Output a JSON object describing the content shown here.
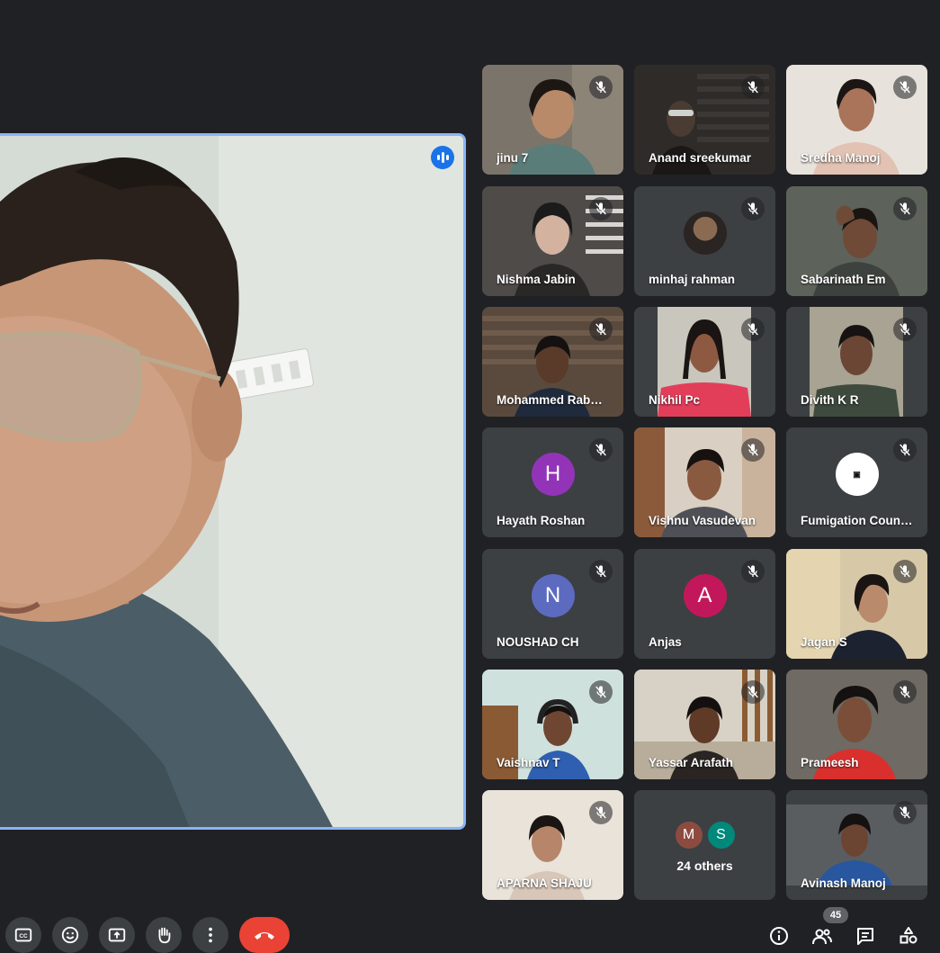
{
  "colors": {
    "background": "#202124",
    "tile": "#3c4043",
    "speaker_outline": "#8ab4f8",
    "speaking_indicator": "#1a73e8",
    "end_call": "#ea4335"
  },
  "main_speaker": {
    "speaking_icon": "audio-level-icon"
  },
  "participants": [
    {
      "name": "jinu 7",
      "muted": true
    },
    {
      "name": "Anand sreekumar",
      "muted": true
    },
    {
      "name": "Sredha Manoj",
      "muted": true
    },
    {
      "name": "Nishma Jabin",
      "muted": true
    },
    {
      "name": "minhaj rahman",
      "muted": true
    },
    {
      "name": "Sabarinath Em",
      "muted": true
    },
    {
      "name": "Mohammed Rab…",
      "muted": true
    },
    {
      "name": "Nikhil Pc",
      "muted": true
    },
    {
      "name": "Divith K R",
      "muted": true
    },
    {
      "name": "Hayath Roshan",
      "muted": true,
      "avatar_letter": "H",
      "avatar_color": "#9334b8"
    },
    {
      "name": "Vishnu Vasudevan",
      "muted": true
    },
    {
      "name": "Fumigation Coun…",
      "muted": true
    },
    {
      "name": "NOUSHAD CH",
      "muted": true,
      "avatar_letter": "N",
      "avatar_color": "#5c6bc0"
    },
    {
      "name": "Anjas",
      "muted": true,
      "avatar_letter": "A",
      "avatar_color": "#c2185b"
    },
    {
      "name": "Jagan S",
      "muted": true
    },
    {
      "name": "Vaishnav T",
      "muted": true
    },
    {
      "name": "Yassar Arafath",
      "muted": true
    },
    {
      "name": "Prameesh",
      "muted": true
    },
    {
      "name": "APARNA SHAJU",
      "muted": true
    },
    {
      "name": "Avinash Manoj",
      "muted": true
    }
  ],
  "others": {
    "label": "24 others",
    "avatars": [
      {
        "letter": "M",
        "color": "#8d4b40"
      },
      {
        "letter": "S",
        "color": "#00897b"
      }
    ]
  },
  "controls": {
    "left": [
      "captions-icon",
      "emoji-icon",
      "present-screen-icon",
      "raise-hand-icon",
      "more-options-icon"
    ],
    "end_call": "end-call-icon",
    "right": [
      "meeting-info-icon",
      "people-icon",
      "chat-icon",
      "activities-icon"
    ],
    "participant_count": "45"
  }
}
